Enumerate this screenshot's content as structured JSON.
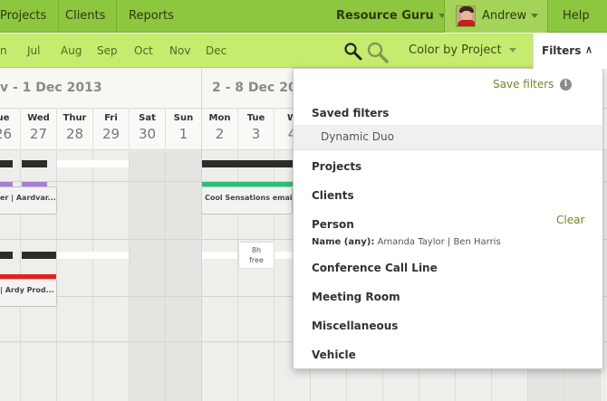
{
  "nav": {
    "projects": "Projects",
    "clients": "Clients",
    "reports": "Reports",
    "brand": "Resource Guru",
    "user_name": "Andrew",
    "help": "Help"
  },
  "toolbar": {
    "months": [
      "n",
      "Jul",
      "Aug",
      "Sep",
      "Oct",
      "Nov",
      "Dec"
    ],
    "color_by": "Color by Project",
    "filters": "Filters",
    "icons": [
      "search-icon",
      "zoom-icon",
      "chevron-up-icon"
    ]
  },
  "weeks": [
    {
      "label": "v - 1 Dec 2013"
    },
    {
      "label": "2 - 8 Dec 20"
    }
  ],
  "days": [
    {
      "name": "ue",
      "date": "26"
    },
    {
      "name": "Wed",
      "date": "27"
    },
    {
      "name": "Thur",
      "date": "28"
    },
    {
      "name": "Fri",
      "date": "29"
    },
    {
      "name": "Sat",
      "date": "30"
    },
    {
      "name": "Sun",
      "date": "1"
    },
    {
      "name": "Mon",
      "date": "2"
    },
    {
      "name": "Tue",
      "date": "3"
    },
    {
      "name": "W",
      "date": "4"
    }
  ],
  "bookings": [
    {
      "label": "er | Aardvar..."
    },
    {
      "label": "Cool Sensations email | ..."
    },
    {
      "label": "| Ardy Prod..."
    }
  ],
  "free_slot": {
    "hours": "8h",
    "label": "free"
  },
  "colors": {
    "nav_bg": "#8dc63f",
    "month_bar_bg": "#c6eb6f",
    "purple_bar": "#a87ddb",
    "green_bar": "#27c07a",
    "red_bar": "#e4201f",
    "link_green": "#6c8a2d"
  },
  "filters_panel": {
    "save_filters": "Save filters",
    "saved_filters_heading": "Saved filters",
    "saved_filters": [
      "Dynamic Duo"
    ],
    "projects": "Projects",
    "clients": "Clients",
    "person": "Person",
    "clear": "Clear",
    "person_filter_label": "Name (any):",
    "person_filter_value": "Amanda Taylor | Ben Harris",
    "conference": "Conference Call Line",
    "meeting_room": "Meeting Room",
    "misc": "Miscellaneous",
    "vehicle": "Vehicle"
  }
}
